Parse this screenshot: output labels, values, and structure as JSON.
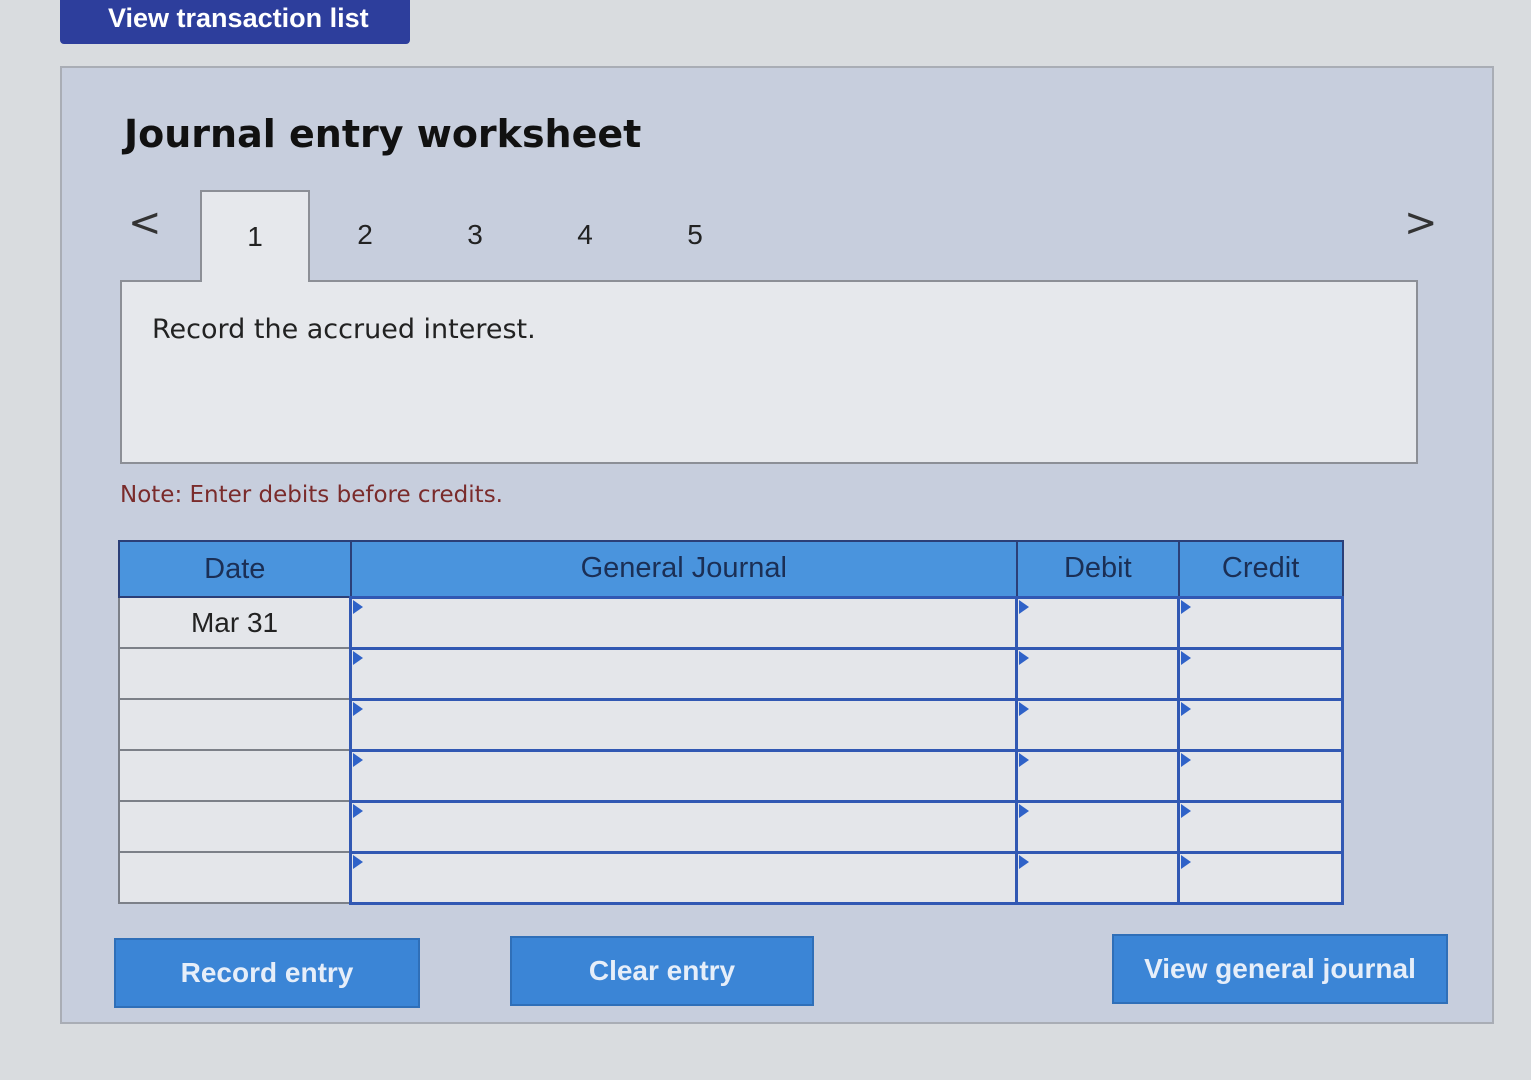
{
  "top_button": {
    "label": "View transaction list"
  },
  "worksheet": {
    "title": "Journal entry worksheet",
    "nav": {
      "prev": "<",
      "next": ">"
    },
    "tabs": [
      "1",
      "2",
      "3",
      "4",
      "5"
    ],
    "active_tab": "1",
    "prompt": "Record the accrued interest.",
    "note": "Note: Enter debits before credits."
  },
  "table": {
    "headers": {
      "date": "Date",
      "journal": "General Journal",
      "debit": "Debit",
      "credit": "Credit"
    },
    "rows": [
      {
        "date": "Mar 31",
        "journal": "",
        "debit": "",
        "credit": ""
      },
      {
        "date": "",
        "journal": "",
        "debit": "",
        "credit": ""
      },
      {
        "date": "",
        "journal": "",
        "debit": "",
        "credit": ""
      },
      {
        "date": "",
        "journal": "",
        "debit": "",
        "credit": ""
      },
      {
        "date": "",
        "journal": "",
        "debit": "",
        "credit": ""
      },
      {
        "date": "",
        "journal": "",
        "debit": "",
        "credit": ""
      }
    ]
  },
  "actions": {
    "record": "Record entry",
    "clear": "Clear entry",
    "view_general_journal": "View general journal"
  }
}
